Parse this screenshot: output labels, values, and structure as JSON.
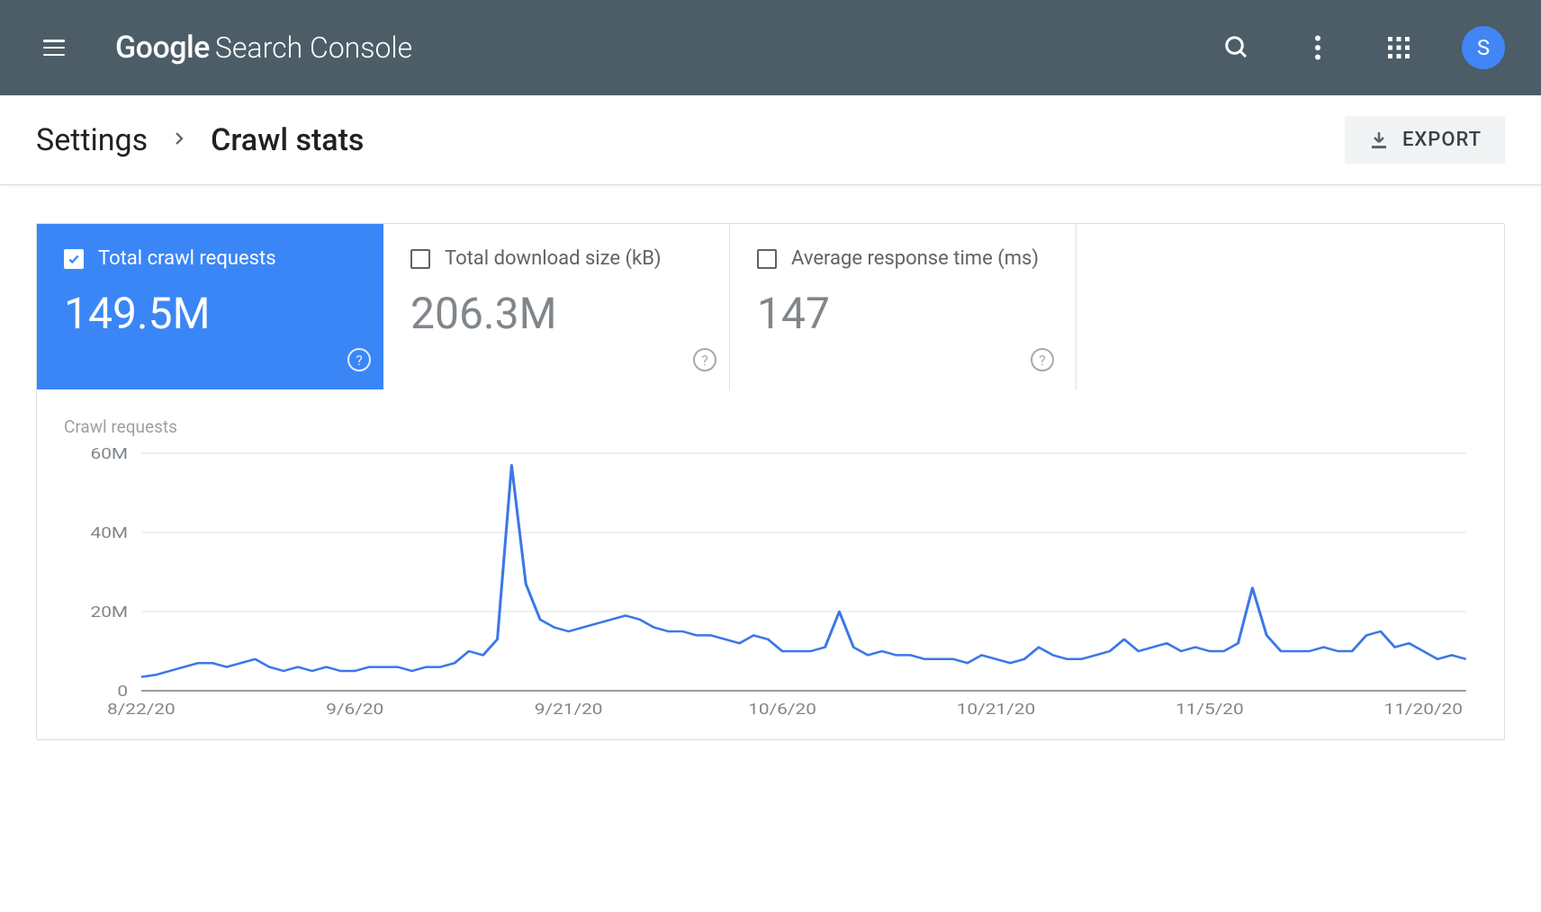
{
  "header": {
    "logo_google": "Google",
    "logo_sc": "Search Console",
    "avatar_letter": "S"
  },
  "breadcrumb": {
    "parent": "Settings",
    "current": "Crawl stats",
    "export_label": "EXPORT"
  },
  "metrics": [
    {
      "label": "Total crawl requests",
      "value": "149.5M",
      "checked": true
    },
    {
      "label": "Total download size (kB)",
      "value": "206.3M",
      "checked": false
    },
    {
      "label": "Average response time (ms)",
      "value": "147",
      "checked": false
    }
  ],
  "chart_data": {
    "type": "line",
    "title": "Crawl requests",
    "ylabel": "",
    "ylim": [
      0,
      60
    ],
    "y_unit": "M",
    "y_ticks": [
      0,
      20,
      40,
      60
    ],
    "x_tick_labels": [
      "8/22/20",
      "9/6/20",
      "9/21/20",
      "10/6/20",
      "10/21/20",
      "11/5/20",
      "11/20/20"
    ],
    "x_tick_positions": [
      0,
      15,
      30,
      45,
      60,
      75,
      90
    ],
    "values": [
      3.5,
      4,
      5,
      6,
      7,
      7,
      6,
      7,
      8,
      6,
      5,
      6,
      5,
      6,
      5,
      5,
      6,
      6,
      6,
      5,
      6,
      6,
      7,
      10,
      9,
      13,
      57,
      27,
      18,
      16,
      15,
      16,
      17,
      18,
      19,
      18,
      16,
      15,
      15,
      14,
      14,
      13,
      12,
      14,
      13,
      10,
      10,
      10,
      11,
      20,
      11,
      9,
      10,
      9,
      9,
      8,
      8,
      8,
      7,
      9,
      8,
      7,
      8,
      11,
      9,
      8,
      8,
      9,
      10,
      13,
      10,
      11,
      12,
      10,
      11,
      10,
      10,
      12,
      26,
      14,
      10,
      10,
      10,
      11,
      10,
      10,
      14,
      15,
      11,
      12,
      10,
      8,
      9,
      8
    ]
  }
}
